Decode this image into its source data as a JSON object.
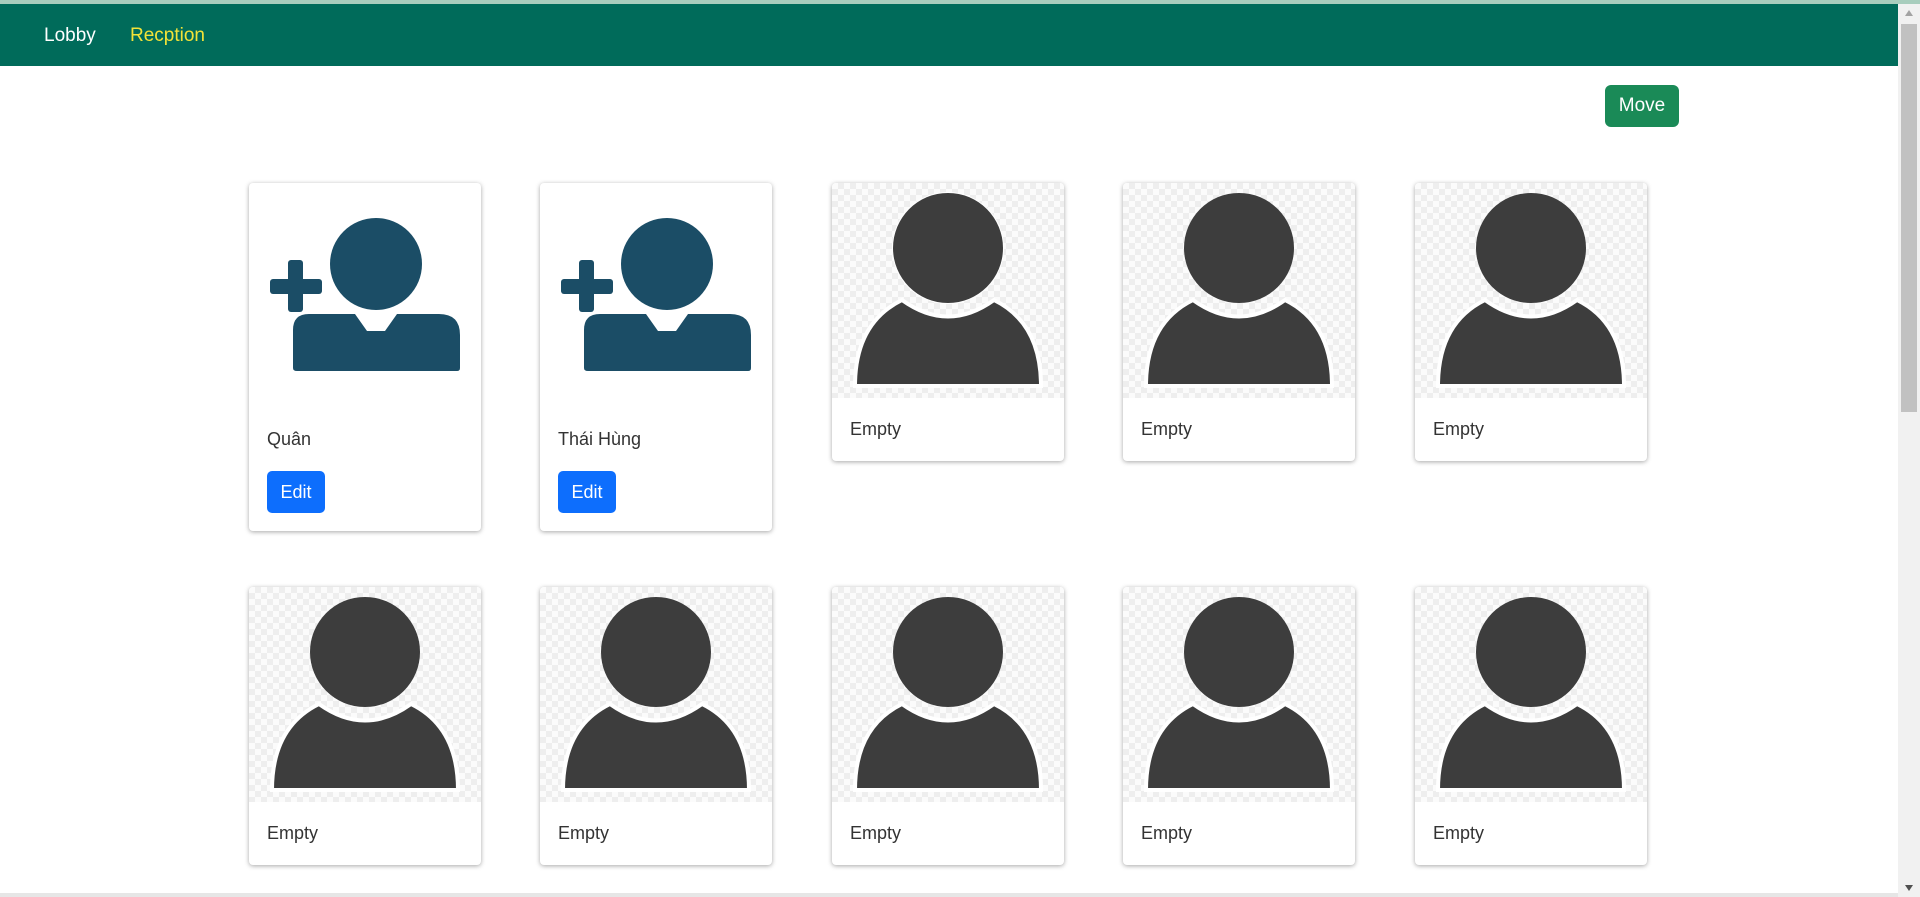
{
  "nav": {
    "links": [
      {
        "label": "Lobby"
      },
      {
        "label": "Recption"
      }
    ]
  },
  "toolbar": {
    "move_label": "Move"
  },
  "rooms": [
    {
      "name": "Quân",
      "status": "occupied",
      "edit_label": "Edit"
    },
    {
      "name": "Thái Hùng",
      "status": "occupied",
      "edit_label": "Edit"
    },
    {
      "name": "Empty",
      "status": "empty"
    },
    {
      "name": "Empty",
      "status": "empty"
    },
    {
      "name": "Empty",
      "status": "empty"
    },
    {
      "name": "Empty",
      "status": "empty"
    },
    {
      "name": "Empty",
      "status": "empty"
    },
    {
      "name": "Empty",
      "status": "empty"
    },
    {
      "name": "Empty",
      "status": "empty"
    },
    {
      "name": "Empty",
      "status": "empty"
    }
  ],
  "colors": {
    "navbar": "#006b5a",
    "active_link": "#f2e338",
    "move_button": "#1a8a57",
    "edit_button": "#0d6efd",
    "occupied_icon": "#1b4d66",
    "empty_icon": "#3d3d3d"
  },
  "icons": {
    "occupied": "add-user-icon",
    "empty": "user-placeholder-icon"
  }
}
